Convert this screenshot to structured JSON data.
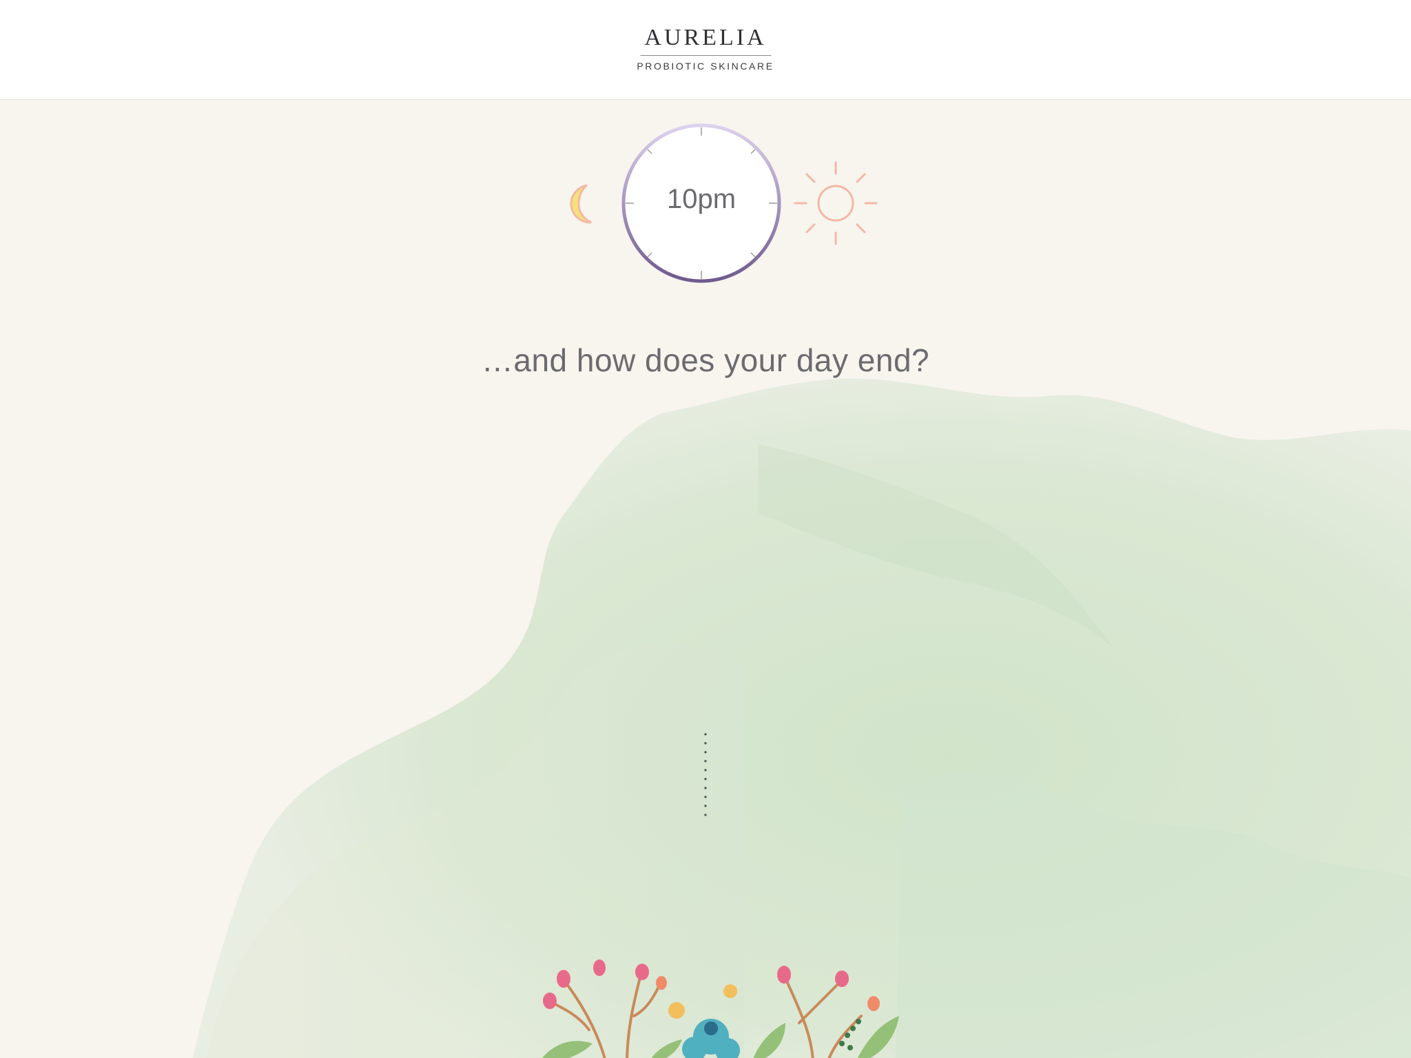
{
  "brand": {
    "name": "AURELIA",
    "tagline": "PROBIOTIC SKINCARE"
  },
  "time_picker": {
    "value": "10pm",
    "left_icon": "moon-icon",
    "right_icon": "sun-icon"
  },
  "question": "…and how does your day end?",
  "colors": {
    "background": "#f8f4ee",
    "wash_green": "#cfe3c8",
    "dial_top": "#d9cdea",
    "dial_bottom": "#6f5a8e",
    "moon": "#f3e27a",
    "sun": "#f2b8a4",
    "text": "#6b6b6f"
  },
  "decor": {
    "scroll_indicator": "dotted-line",
    "illustration": "watercolor-bouquet"
  }
}
